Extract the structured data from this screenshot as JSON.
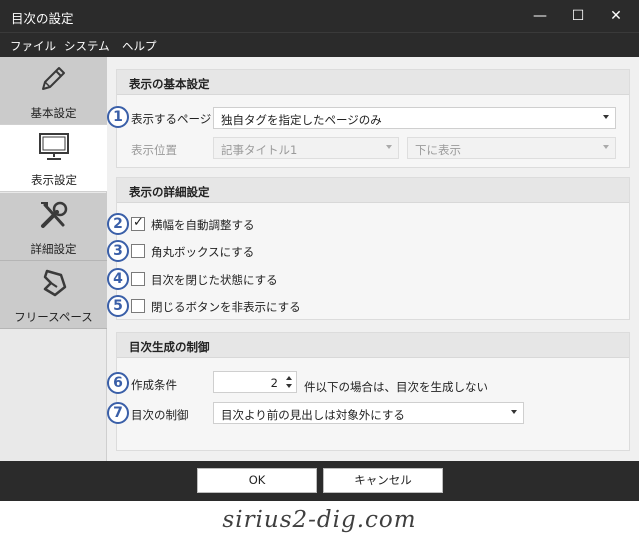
{
  "window": {
    "title": "目次の設定",
    "minimize": "—",
    "maximize": "☐",
    "close": "✕"
  },
  "menu": [
    "ファイル",
    "システム",
    "ヘルプ"
  ],
  "sidebar": {
    "items": [
      {
        "label": "基本設定",
        "icon": "pencil-icon",
        "active": false
      },
      {
        "label": "表示設定",
        "icon": "monitor-icon",
        "active": true
      },
      {
        "label": "詳細設定",
        "icon": "tools-icon",
        "active": false
      },
      {
        "label": "フリースペース",
        "icon": "free-space-icon",
        "active": false
      }
    ]
  },
  "basic": {
    "heading": "表示の基本設定",
    "page_label": "表示するページ",
    "page_value": "独自タグを指定したページのみ",
    "position_label": "表示位置",
    "position_value": "記事タイトル1",
    "position_side": "下に表示"
  },
  "detail": {
    "heading": "表示の詳細設定",
    "options": [
      {
        "label": "横幅を自動調整する",
        "checked": true
      },
      {
        "label": "角丸ボックスにする",
        "checked": false
      },
      {
        "label": "目次を閉じた状態にする",
        "checked": false
      },
      {
        "label": "閉じるボタンを非表示にする",
        "checked": false
      }
    ]
  },
  "control": {
    "heading": "目次生成の制御",
    "condition_label": "作成条件",
    "condition_value": "2",
    "condition_suffix": "件以下の場合は、目次を生成しない",
    "control_label": "目次の制御",
    "control_value": "目次より前の見出しは対象外にする"
  },
  "badges": [
    "1",
    "2",
    "3",
    "4",
    "5",
    "6",
    "7"
  ],
  "buttons": {
    "ok": "OK",
    "cancel": "キャンセル"
  },
  "watermark": "sirius2-dig.com",
  "colors": {
    "badge": "#3a5fa8",
    "chrome": "#2b2b2b"
  }
}
